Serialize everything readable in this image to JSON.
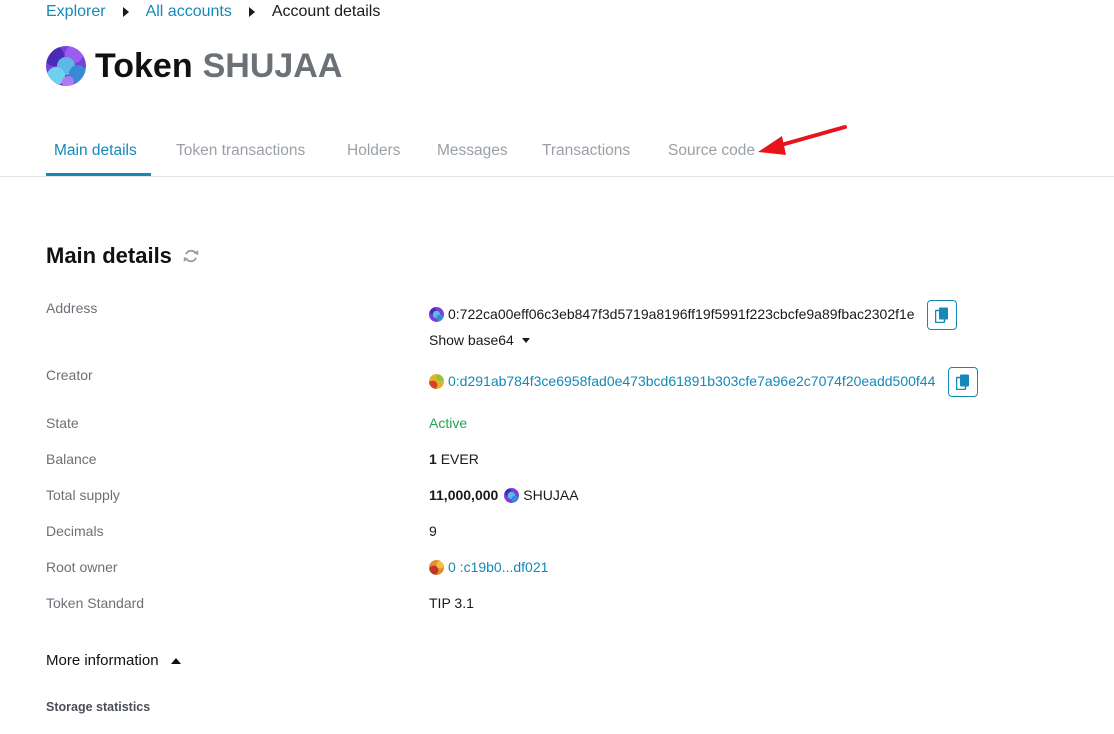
{
  "breadcrumb": {
    "explorer": "Explorer",
    "all_accounts": "All accounts",
    "current": "Account details"
  },
  "header": {
    "title_prefix": "Token",
    "title_symbol": "SHUJAA"
  },
  "tabs": [
    {
      "label": "Main details",
      "active": true
    },
    {
      "label": "Token transactions",
      "active": false
    },
    {
      "label": "Holders",
      "active": false
    },
    {
      "label": "Messages",
      "active": false
    },
    {
      "label": "Transactions",
      "active": false
    },
    {
      "label": "Source code",
      "active": false
    }
  ],
  "main": {
    "section_title": "Main details",
    "rows": {
      "address": {
        "label": "Address",
        "value": "0:722ca00eff06c3eb847f3d5719a8196ff19f5991f223cbcfe9a89fbac2302f1e"
      },
      "show_base64": "Show base64",
      "creator": {
        "label": "Creator",
        "value": "0:d291ab784f3ce6958fad0e473bcd61891b303cfe7a96e2c7074f20eadd500f44"
      },
      "state": {
        "label": "State",
        "value": "Active"
      },
      "balance": {
        "label": "Balance",
        "amount": "1",
        "unit": "EVER"
      },
      "total_supply": {
        "label": "Total supply",
        "amount": "11,000,000",
        "unit": "SHUJAA"
      },
      "decimals": {
        "label": "Decimals",
        "value": "9"
      },
      "root_owner": {
        "label": "Root owner",
        "value": "0 :c19b0...df021"
      },
      "token_standard": {
        "label": "Token Standard",
        "value": "TIP 3.1"
      }
    },
    "more_information": "More information",
    "storage_statistics": "Storage statistics"
  },
  "colors": {
    "accent": "#1489b8",
    "active_green": "#2aa24e",
    "annotation_arrow": "#e8141c"
  }
}
